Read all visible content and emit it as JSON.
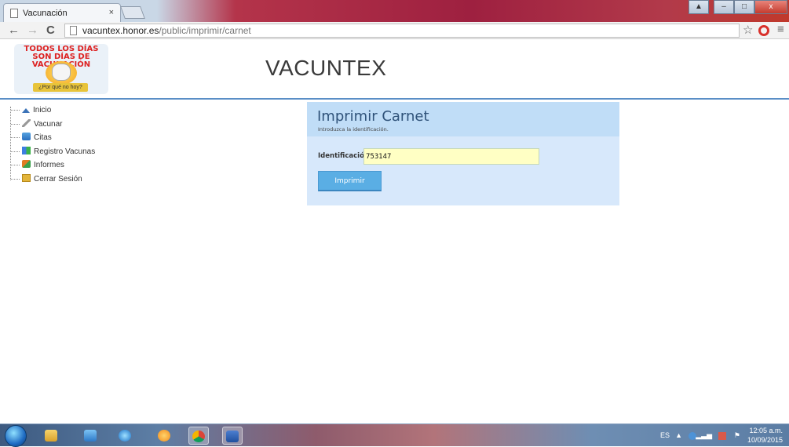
{
  "browser": {
    "tab_title": "Vacunación",
    "tab_close": "×",
    "url_host": "vacuntex.honor.es",
    "url_path": "/public/imprimir/carnet",
    "nav_back": "←",
    "nav_forward": "→",
    "nav_reload": "C",
    "bookmark_star": "☆",
    "menu": "≡",
    "window_buttons": {
      "user": "▲",
      "minimize": "–",
      "maximize": "□",
      "close": "x"
    }
  },
  "header": {
    "logo_banner": "TODOS LOS DÍAS SON DÍAS DE VACUNACIÓN",
    "logo_ribbon": "¿Por qué no hoy?",
    "site_title": "VACUNTEX"
  },
  "sidebar": {
    "items": [
      {
        "label": "Inicio",
        "icon": "home-icon"
      },
      {
        "label": "Vacunar",
        "icon": "syringe-icon"
      },
      {
        "label": "Citas",
        "icon": "calendar-icon"
      },
      {
        "label": "Registro Vacunas",
        "icon": "registry-icon"
      },
      {
        "label": "Informes",
        "icon": "report-icon"
      },
      {
        "label": "Cerrar Sesión",
        "icon": "logout-icon"
      }
    ]
  },
  "form": {
    "title": "Imprimir Carnet",
    "subtitle": "Introduzca la identificación.",
    "id_label": "Identificación",
    "id_value": "753147",
    "submit_label": "Imprimir"
  },
  "taskbar": {
    "apps": [
      "explorer",
      "media-player",
      "internet-explorer",
      "avast",
      "chrome",
      "word"
    ],
    "lang": "ES",
    "time": "12:05 a.m.",
    "date": "10/09/2015"
  },
  "colors": {
    "panel_bg": "#d7e8fb",
    "panel_header": "#c0ddf7",
    "input_bg": "#ffffc4",
    "button": "#5aaee4",
    "header_rule": "#5a8ec6"
  }
}
